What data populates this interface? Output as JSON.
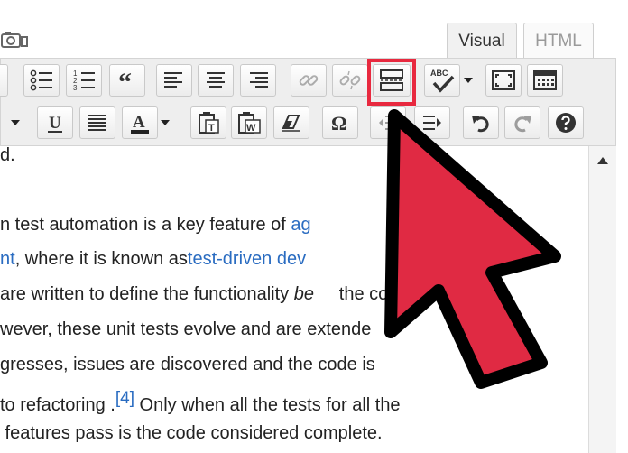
{
  "tabs": {
    "visual": "Visual",
    "html": "HTML"
  },
  "toolbar": {
    "row1": [
      "bullet-list-icon",
      "numbered-list-icon",
      "blockquote-icon",
      "align-left-icon",
      "align-center-icon",
      "align-right-icon",
      "insert-link-icon",
      "unlink-icon",
      "insert-more-tag-icon",
      "spellcheck-icon",
      "fullscreen-icon",
      "kitchen-sink-icon"
    ],
    "row2": [
      "underline-icon",
      "justify-icon",
      "text-color-icon",
      "paste-as-text-icon",
      "paste-from-word-icon",
      "clear-formatting-icon",
      "special-character-icon",
      "outdent-icon",
      "indent-icon",
      "undo-icon",
      "redo-icon",
      "help-icon"
    ],
    "underline_glyph": "U",
    "color_glyph": "A",
    "omega_glyph": "Ω",
    "spell_glyph": "ABC",
    "paste_text_glyph": "T",
    "paste_word_glyph": "W"
  },
  "colors": {
    "highlight": "#e8293f",
    "link": "#2a6cc1",
    "cursor_fill": "#e02a43"
  },
  "content": {
    "l1": "d.",
    "l2a": "n test automation is a key feature of ",
    "l2link": "ag",
    "l3link1": "nt",
    "l3a": ", where it is known as",
    "l3link2": "test-driven dev",
    "l4a": "are written to define the functionality ",
    "l4b": "be",
    "l4c": "     the code is",
    "l5a": "wever, these unit tests evolve and are extende",
    "l6a": "gresses, issues are discovered and the code is",
    "l7a": "to refactoring .",
    "l7ref": "[4]",
    "l7b": " Only when all the tests for all the",
    "l8a": " features pass is the code considered complete."
  }
}
